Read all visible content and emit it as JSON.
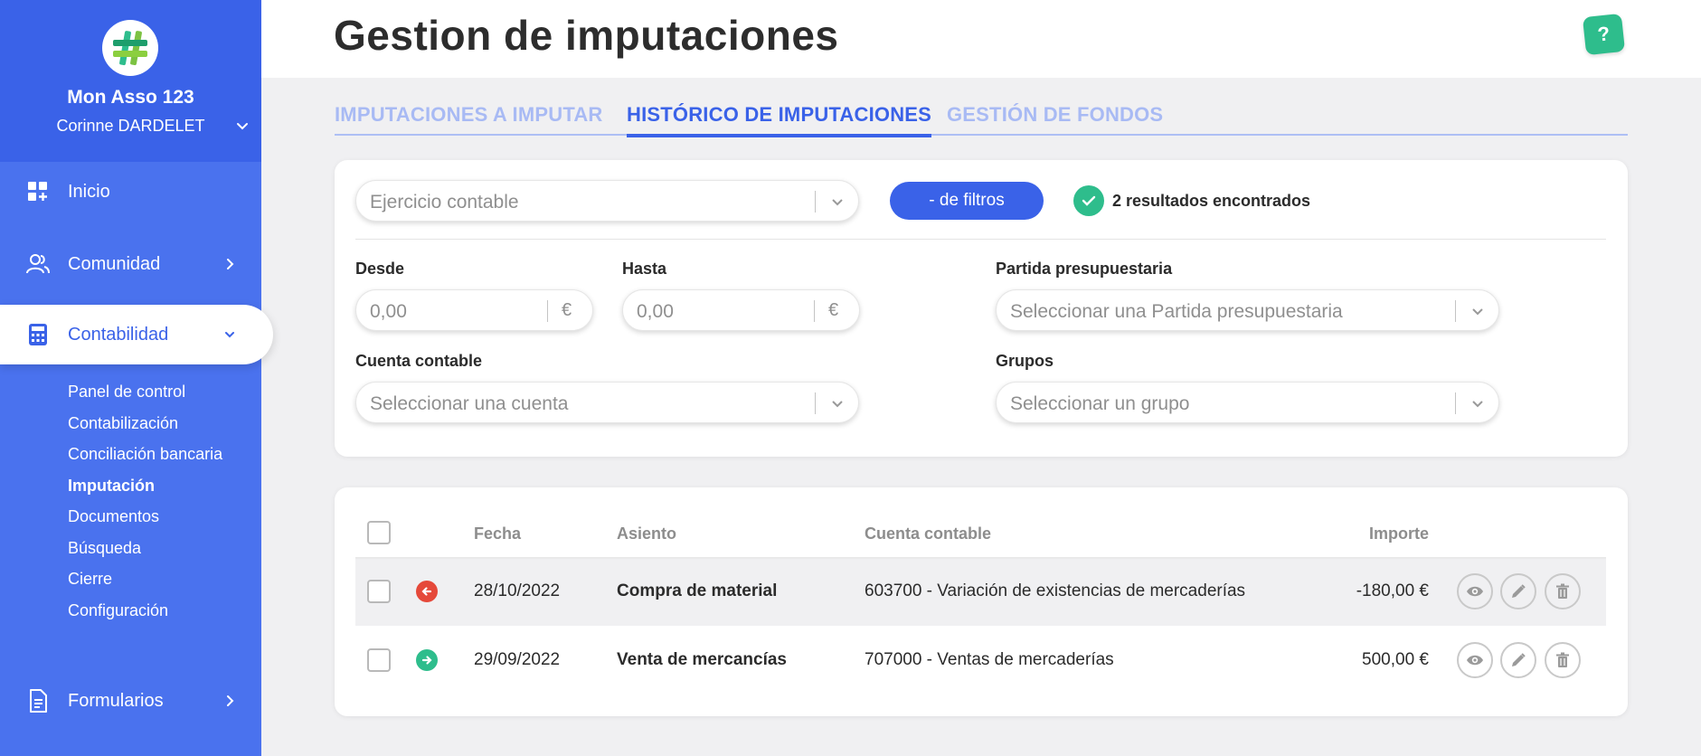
{
  "sidebar": {
    "org_name": "Mon Asso 123",
    "user_name": "Corinne DARDELET",
    "items": [
      {
        "label": "Inicio"
      },
      {
        "label": "Comunidad"
      },
      {
        "label": "Contabilidad"
      },
      {
        "label": "Formularios"
      }
    ],
    "subitems": [
      {
        "label": "Panel de control"
      },
      {
        "label": "Contabilización"
      },
      {
        "label": "Conciliación bancaria"
      },
      {
        "label": "Imputación"
      },
      {
        "label": "Documentos"
      },
      {
        "label": "Búsqueda"
      },
      {
        "label": "Cierre"
      },
      {
        "label": "Configuración"
      }
    ]
  },
  "header": {
    "title": "Gestion de imputaciones",
    "help": "?"
  },
  "tabs": [
    {
      "label": "IMPUTACIONES A IMPUTAR"
    },
    {
      "label": "HISTÓRICO DE IMPUTACIONES"
    },
    {
      "label": "GESTIÓN DE FONDOS"
    }
  ],
  "filters": {
    "ejercicio_placeholder": "Ejercicio contable",
    "toggle_label": "- de filtros",
    "results_text": "2 resultados encontrados",
    "desde_label": "Desde",
    "desde_value": "0,00",
    "hasta_label": "Hasta",
    "hasta_value": "0,00",
    "currency": "€",
    "partida_label": "Partida presupuestaria",
    "partida_placeholder": "Seleccionar una Partida presupuestaria",
    "cuenta_label": "Cuenta contable",
    "cuenta_placeholder": "Seleccionar una cuenta",
    "grupos_label": "Grupos",
    "grupos_placeholder": "Seleccionar un grupo"
  },
  "table": {
    "headers": {
      "fecha": "Fecha",
      "asiento": "Asiento",
      "cuenta": "Cuenta contable",
      "importe": "Importe"
    },
    "rows": [
      {
        "fecha": "28/10/2022",
        "asiento": "Compra de material",
        "cuenta": "603700 - Variación de existencias de mercaderías",
        "importe": "-180,00 €",
        "direction": "out",
        "color": "#e5493a"
      },
      {
        "fecha": "29/09/2022",
        "asiento": "Venta de mercancías",
        "cuenta": "707000 - Ventas de mercaderías",
        "importe": "500,00 €",
        "direction": "in",
        "color": "#2ebd8c"
      }
    ]
  },
  "colors": {
    "sidebar": "#4a72ee",
    "accent": "#3a62e8",
    "success": "#2ebd8c",
    "danger": "#e5493a"
  }
}
